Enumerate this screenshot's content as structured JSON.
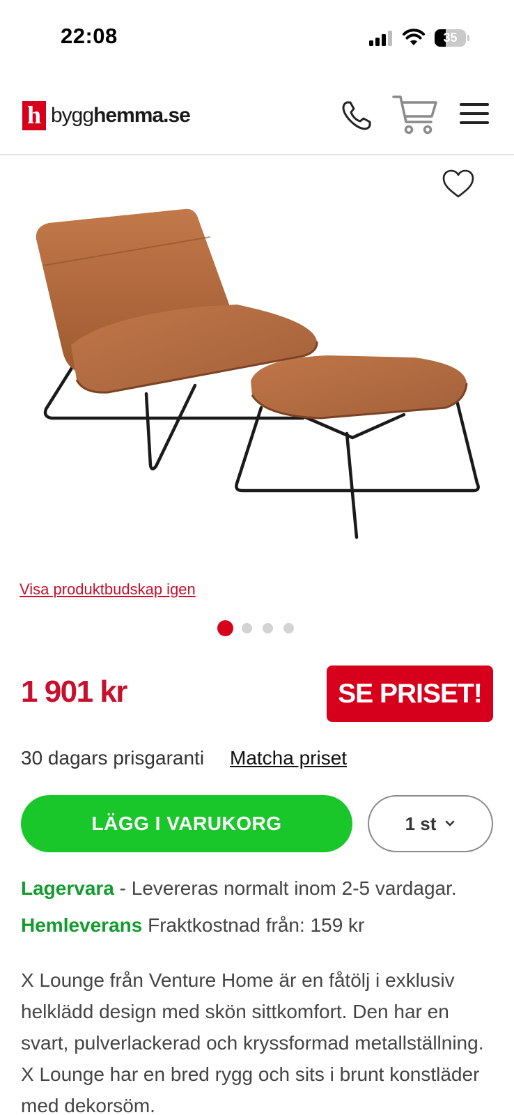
{
  "status_bar": {
    "time": "22:08",
    "battery_level": "35",
    "battery_fraction": 0.35
  },
  "header": {
    "logo_mark": "h",
    "logo_text_light": "bygg",
    "logo_text_bold": "hemma",
    "logo_text_suffix": ".se",
    "icons": [
      "phone-icon",
      "cart-icon",
      "menu-icon"
    ]
  },
  "gallery": {
    "favorite_icon": "heart-icon",
    "image_description_icon": "lounge-chair-with-ottoman",
    "show_product_message_link": "Visa produktbudskap igen",
    "slide_count": 4,
    "active_slide": 1
  },
  "pricing": {
    "price": "1 901 kr",
    "see_price_button": "SE PRISET!",
    "guarantee_text": "30 dagars prisgaranti",
    "match_price_link": "Matcha priset"
  },
  "purchase": {
    "add_to_cart_button": "LÄGG I VARUKORG",
    "quantity_label": "1 st"
  },
  "delivery": {
    "stock_label": "Lagervara",
    "stock_text": " - Levereras normalt inom 2-5 vardagar.",
    "home_delivery_label": "Hemleverans",
    "home_delivery_text": " Fraktkostnad från: 159 kr"
  },
  "description": {
    "text": "X Lounge från Venture Home är en fåtölj i exklusiv helklädd design med skön sittkomfort. Den har en svart, pulverlackerad och kryssformad metallställning. X Lounge har en bred rygg och sits i brunt konstläder med dekorsöm."
  },
  "colors": {
    "brand_red": "#d6001c",
    "cta_green": "#1ac72b",
    "stock_green": "#119c2d"
  }
}
